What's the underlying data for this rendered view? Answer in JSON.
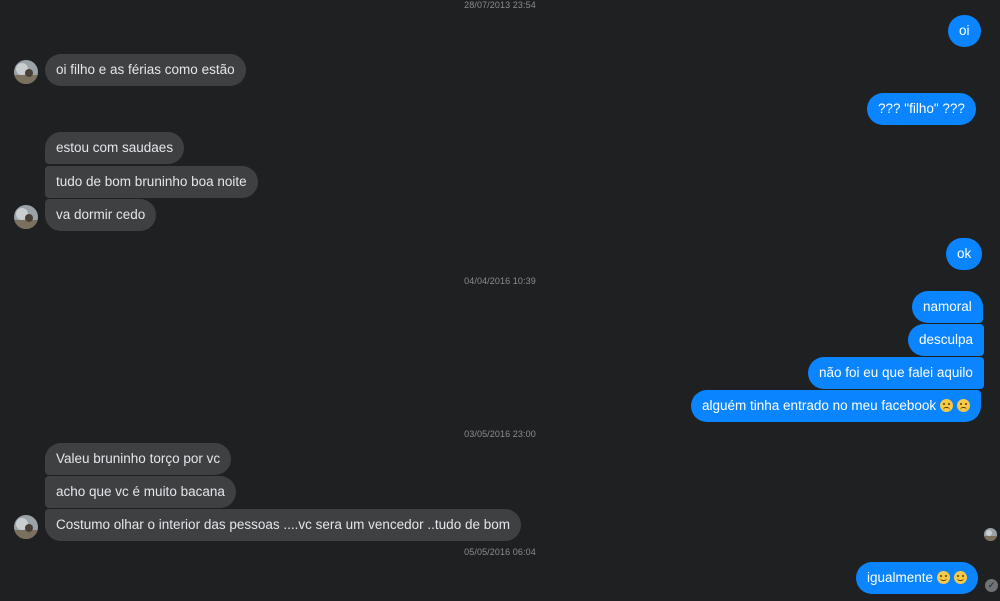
{
  "timestamps": [
    "28/07/2013 23:54",
    "04/04/2016 10:39",
    "03/05/2016 23:00",
    "05/05/2016 06:04"
  ],
  "messages": {
    "m1": "oi",
    "m2": "oi filho e as férias como estão",
    "m3": "??? \"filho\" ???",
    "m4": "estou com saudaes",
    "m5": "tudo de bom bruninho boa noite",
    "m6": "va dormir cedo",
    "m7": "ok",
    "m8": "namoral",
    "m9": "desculpa",
    "m10": "não foi eu que falei aquilo",
    "m11": "alguém tinha entrado no meu facebook",
    "m12": "Valeu bruninho torço por vc",
    "m13": "acho que vc é muito bacana",
    "m14": "Costumo olhar o interior das pessoas ....vc sera um vencedor  ..tudo de bom",
    "m15": "igualmente"
  },
  "icons": {
    "avatar": "contact-avatar",
    "emoji_a": "confused-face-emoji",
    "emoji_b": "sad-face-emoji",
    "emoji_c": "slightly-smiling-face-emoji",
    "emoji_d": "winking-face-emoji",
    "seen": "seen-avatar",
    "delivered": "delivered-check-icon"
  },
  "colors": {
    "background": "#1f2022",
    "incoming_bubble": "#3e4042",
    "outgoing_bubble": "#0a84ff",
    "timestamp_text": "#8a8d91"
  }
}
